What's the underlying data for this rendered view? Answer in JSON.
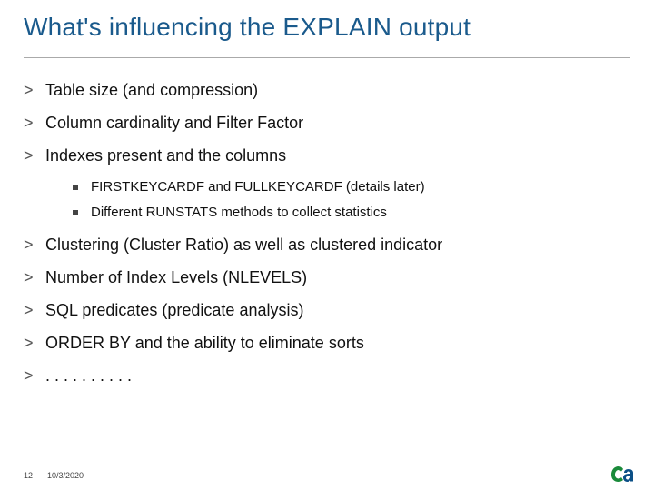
{
  "title": "What's influencing the EXPLAIN output",
  "bullets": [
    {
      "text": "Table size (and compression)"
    },
    {
      "text": "Column cardinality and Filter Factor"
    },
    {
      "text": "Indexes present and the columns",
      "sub": [
        "FIRSTKEYCARDF and FULLKEYCARDF (details later)",
        "Different RUNSTATS methods to collect statistics"
      ]
    },
    {
      "text": "Clustering (Cluster Ratio) as well as clustered indicator"
    },
    {
      "text": "Number of Index Levels (NLEVELS)"
    },
    {
      "text": "SQL predicates (predicate analysis)"
    },
    {
      "text": "ORDER BY and the ability to eliminate sorts"
    },
    {
      "text": ". . . . . . . . . ."
    }
  ],
  "footer": {
    "page": "12",
    "date": "10/3/2020"
  }
}
